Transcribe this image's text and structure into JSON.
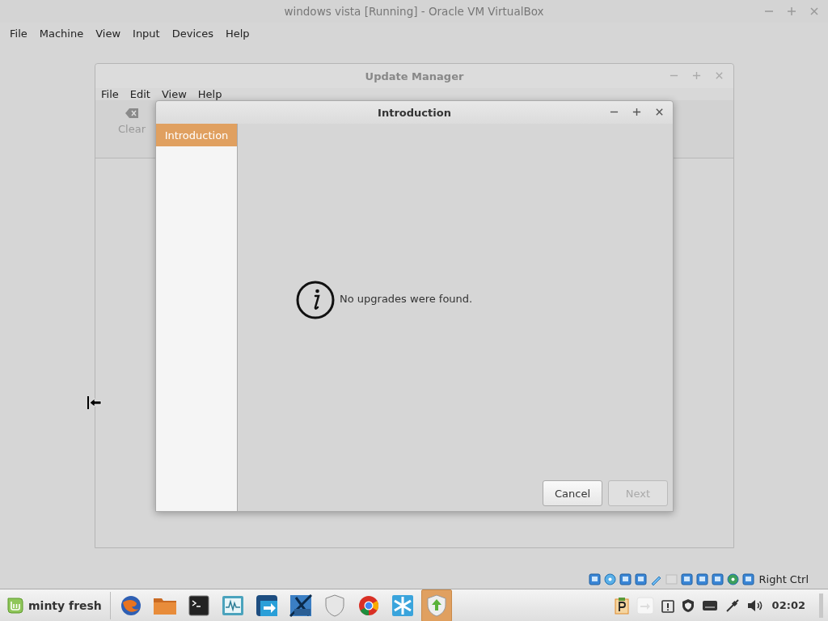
{
  "vm_window": {
    "title": "windows vista [Running] - Oracle VM VirtualBox",
    "menu": [
      "File",
      "Machine",
      "View",
      "Input",
      "Devices",
      "Help"
    ],
    "status_bar": {
      "host_key": "Right Ctrl"
    }
  },
  "update_manager": {
    "title": "Update Manager",
    "menu": [
      "File",
      "Edit",
      "View",
      "Help"
    ],
    "toolbar": [
      {
        "label": "Clear",
        "disabled": true
      }
    ]
  },
  "dialog": {
    "title": "Introduction",
    "steps": [
      {
        "label": "Introduction",
        "selected": true
      }
    ],
    "message": "No upgrades were found.",
    "buttons": [
      {
        "label": "Cancel",
        "disabled": false
      },
      {
        "label": "Next",
        "disabled": true
      }
    ]
  },
  "taskbar": {
    "menu_label": "minty fresh",
    "launchers": [
      {
        "kind": "fox",
        "active": false
      },
      {
        "kind": "folder",
        "active": false
      },
      {
        "kind": "terminal",
        "active": false
      },
      {
        "kind": "monitor",
        "active": false
      },
      {
        "kind": "transfer",
        "active": false
      },
      {
        "kind": "vm",
        "active": false
      },
      {
        "kind": "shield",
        "active": false
      },
      {
        "kind": "wheel",
        "active": false
      },
      {
        "kind": "snowflake",
        "active": false
      },
      {
        "kind": "updater",
        "active": true
      }
    ],
    "clock": "02:02"
  }
}
